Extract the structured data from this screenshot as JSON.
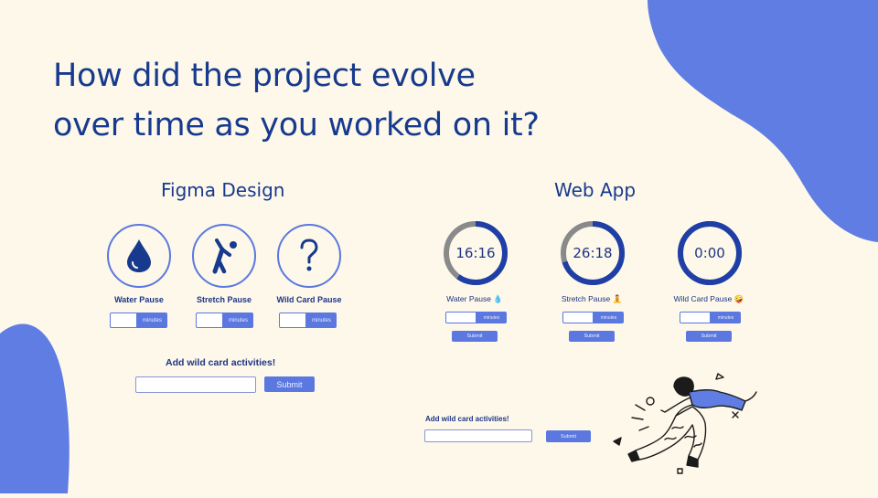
{
  "slide": {
    "heading_line1": "How did the project evolve",
    "heading_line2": "over time as you worked on it?",
    "accent_color": "#5f7de2",
    "text_color": "#173a8e",
    "background_color": "#fdf8ea"
  },
  "figma": {
    "title": "Figma Design",
    "cards": [
      {
        "label": "Water Pause",
        "icon": "water-drop-icon",
        "unit": "minutes"
      },
      {
        "label": "Stretch Pause",
        "icon": "stretch-person-icon",
        "unit": "minutes"
      },
      {
        "label": "Wild Card Pause",
        "icon": "question-mark-icon",
        "unit": "minutes"
      }
    ],
    "add_label": "Add wild card activities!",
    "submit_label": "Submit"
  },
  "webapp": {
    "title": "Web App",
    "timers": [
      {
        "time": "16:16",
        "label": "Water Pause 💧",
        "progress": 0.6,
        "unit": "minutes",
        "submit_label": "Submit"
      },
      {
        "time": "26:18",
        "label": "Stretch Pause 🧘",
        "progress": 0.7,
        "unit": "minutes",
        "submit_label": "Submit"
      },
      {
        "time": "0:00",
        "label": "Wild Card Pause 🤪",
        "progress": 1.0,
        "unit": "minutes",
        "submit_label": "Submit"
      }
    ],
    "add_label": "Add wild card activities!",
    "submit_label": "Submit"
  },
  "illustration": {
    "icon": "jumping-person-illustration"
  }
}
